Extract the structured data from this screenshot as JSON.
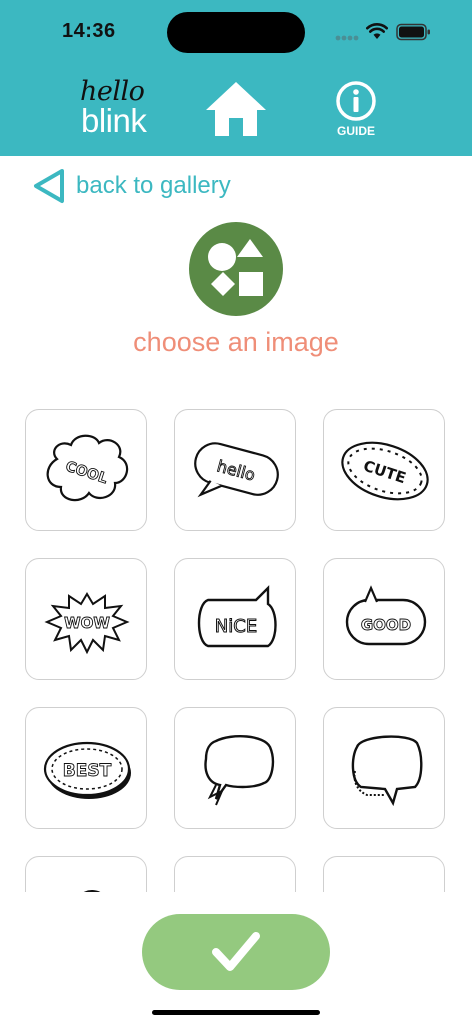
{
  "status_bar": {
    "time": "14:36"
  },
  "header": {
    "logo_top": "hello",
    "logo_bottom": "blink",
    "guide_label": "GUIDE",
    "accent_color": "#3cb8c1"
  },
  "nav": {
    "back_label": "back to gallery"
  },
  "main": {
    "choose_label": "choose an image",
    "icon_color": "#5a8a46",
    "label_color": "#ef8e78"
  },
  "gallery": {
    "items": [
      {
        "icon": "cloud-bubble-cool-icon",
        "text": "COOL"
      },
      {
        "icon": "speech-bubble-hello-icon",
        "text": "hello"
      },
      {
        "icon": "dotted-bubble-cute-icon",
        "text": "CUTE"
      },
      {
        "icon": "burst-bubble-wow-icon",
        "text": "WOW"
      },
      {
        "icon": "speech-bubble-nice-icon",
        "text": "NiCE"
      },
      {
        "icon": "speech-bubble-good-icon",
        "text": "GOOD"
      },
      {
        "icon": "oval-bubble-best-icon",
        "text": "BEST"
      },
      {
        "icon": "empty-speech-bubble-icon"
      },
      {
        "icon": "empty-3d-speech-bubble-icon"
      },
      {
        "icon": "cloud-bubble-icon"
      },
      {
        "icon": "cloud-bubble-icon"
      },
      {
        "icon": "cloud-bubble-icon"
      }
    ]
  },
  "footer": {
    "confirm_icon": "checkmark-icon",
    "confirm_color": "#94c97f"
  }
}
